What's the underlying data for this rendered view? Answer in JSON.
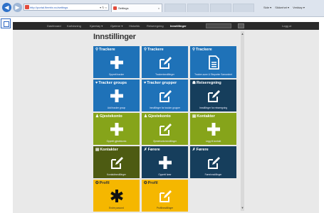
{
  "browser": {
    "url": "http://portal.fleetrix.no/settings",
    "tab_title": "Settings",
    "back_glyph": "◀",
    "fwd_glyph": "▶",
    "close_glyph": "x",
    "addr_ctrls": "▾ ↻ ×",
    "command_bar": [
      "Side ▾",
      "Sikkerhet ▾",
      "Verktøy ▾"
    ]
  },
  "nav": {
    "items": [
      "Dashboard",
      "Kartvisning",
      "Kjøretøy ▾",
      "Gjøtene ▾",
      "Historikk",
      "Reiseregning",
      "Innstillinger"
    ],
    "active": "Innstillinger",
    "logout": "Logg ut"
  },
  "page": {
    "title": "Innstillinger"
  },
  "tiles": [
    {
      "title": "Trackere",
      "glyph": "⚲",
      "icon": "plus-icon",
      "sub": "Opprett tracker",
      "color": "#1f72b8"
    },
    {
      "title": "Trackere",
      "glyph": "⚲",
      "icon": "edit-icon",
      "sub": "Trackerinnstillinger",
      "color": "#1f72b8"
    },
    {
      "title": "Trackere",
      "glyph": "⚲",
      "icon": "document-icon",
      "sub": "Tracker-sone & Eksporter Samordnet",
      "color": "#1f72b8"
    },
    {
      "title": "Tracker groups",
      "glyph": "♥",
      "icon": "plus-icon",
      "sub": "Add tracker group",
      "color": "#1f72b8"
    },
    {
      "title": "Tracker grupper",
      "glyph": "♥",
      "icon": "edit-icon",
      "sub": "Innstillinger for tracker grupper",
      "color": "#1f72b8"
    },
    {
      "title": "Reiseregning",
      "glyph": "☗",
      "icon": "edit-icon",
      "sub": "Innstillinger for reiseregning",
      "color": "#163e5c"
    },
    {
      "title": "Gjestekonto",
      "glyph": "♟",
      "icon": "plus-icon",
      "sub": "Opprett gjestekonto",
      "color": "#86a41a"
    },
    {
      "title": "Gjestekonto",
      "glyph": "♟",
      "icon": "edit-icon",
      "sub": "Gjestekontoinnstillinger",
      "color": "#86a41a"
    },
    {
      "title": "Kontakter",
      "glyph": "▤",
      "icon": "plus-icon",
      "sub": "Legg til kontakt",
      "color": "#86a41a"
    },
    {
      "title": "Kontakter",
      "glyph": "▤",
      "icon": "edit-icon",
      "sub": "Kontaktinnstillinger",
      "color": "#4d5b12"
    },
    {
      "title": "Førere",
      "glyph": "✗",
      "icon": "plus-icon",
      "sub": "Opprett fører",
      "color": "#163e5c"
    },
    {
      "title": "Førere",
      "glyph": "✗",
      "icon": "edit-icon",
      "sub": "Førerinnstillinger",
      "color": "#163e5c"
    },
    {
      "title": "Profil",
      "glyph": "✪",
      "icon": "asterisk-icon",
      "sub": "Endre passord",
      "color": "#f5b700"
    },
    {
      "title": "Profil",
      "glyph": "✪",
      "icon": "edit-icon",
      "sub": "Profilinnstillinger",
      "color": "#f5b700"
    }
  ]
}
